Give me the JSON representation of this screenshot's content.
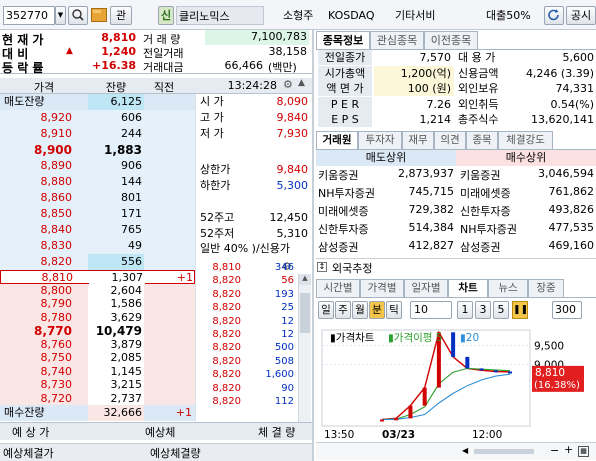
{
  "top": {
    "code": "352770",
    "btn_gwan": "관",
    "btn_sin": "신",
    "name": "클리노믹스",
    "size_cat": "소형주",
    "market": "KOSDAQ",
    "sector": "기타서비",
    "margin": "대출50%",
    "public_btn": "공시"
  },
  "summary": {
    "labels": [
      "현 재 가",
      "대    비",
      "등 락 률"
    ],
    "price": "8,810",
    "change_arrow": "▲",
    "change": "1,240",
    "rate": "+16.38",
    "vol_label": "거 래 량",
    "vol": "7,100,783",
    "prev_vol_label": "전일거래",
    "prev_vol": "38,158",
    "amount_label": "거래대금",
    "amount": "66,466",
    "amount_unit": "(백만)"
  },
  "ob_header": {
    "price": "가격",
    "remain": "잔량",
    "prev": "직전",
    "time": "13:24:28"
  },
  "ask_total_label": "매도잔량",
  "ask_total": "6,125",
  "asks": [
    {
      "p": "8,920",
      "q": "606"
    },
    {
      "p": "8,910",
      "q": "244"
    },
    {
      "p": "8,900",
      "q": "1,883"
    },
    {
      "p": "8,890",
      "q": "906"
    },
    {
      "p": "8,880",
      "q": "144"
    },
    {
      "p": "8,860",
      "q": "801"
    },
    {
      "p": "8,850",
      "q": "171"
    },
    {
      "p": "8,840",
      "q": "765"
    },
    {
      "p": "8,830",
      "q": "49"
    },
    {
      "p": "8,820",
      "q": "556"
    }
  ],
  "bids": [
    {
      "p": "8,810",
      "q": "1,307",
      "ex": "+1"
    },
    {
      "p": "8,800",
      "q": "2,604",
      "ex": ""
    },
    {
      "p": "8,790",
      "q": "1,586",
      "ex": ""
    },
    {
      "p": "8,780",
      "q": "3,629",
      "ex": ""
    },
    {
      "p": "8,770",
      "q": "10,479",
      "ex": ""
    },
    {
      "p": "8,760",
      "q": "3,879",
      "ex": ""
    },
    {
      "p": "8,750",
      "q": "2,085",
      "ex": ""
    },
    {
      "p": "8,740",
      "q": "1,145",
      "ex": ""
    },
    {
      "p": "8,730",
      "q": "3,215",
      "ex": ""
    },
    {
      "p": "8,720",
      "q": "2,737",
      "ex": ""
    }
  ],
  "bid_total_label": "매수잔량",
  "bid_total": "32,666",
  "bid_total_ex": "+1",
  "ob_footer": {
    "exp_price": "예 상 가",
    "exp_vol": "예상체",
    "exec_qty": "체 결 량"
  },
  "status_bar": {
    "a": "예상체결가",
    "b": "예상체결량"
  },
  "info": {
    "open_l": "시  가",
    "open": "8,090",
    "high_l": "고  가",
    "high": "9,840",
    "low_l": "저  가",
    "low": "7,930",
    "upper_l": "상한가",
    "upper": "9,840",
    "lower_l": "하한가",
    "lower": "5,300",
    "w52h_l": "52주고",
    "w52h": "12,450",
    "w52l_l": "52주저",
    "w52l": "5,310",
    "margin_line": "일반 40% )/신용가"
  },
  "ticks": [
    {
      "p": "8,810",
      "v": "346"
    },
    {
      "p": "8,820",
      "v": "56"
    },
    {
      "p": "8,820",
      "v": "193"
    },
    {
      "p": "8,820",
      "v": "25"
    },
    {
      "p": "8,820",
      "v": "12"
    },
    {
      "p": "8,820",
      "v": "12"
    },
    {
      "p": "8,820",
      "v": "500"
    },
    {
      "p": "8,820",
      "v": "508"
    },
    {
      "p": "8,820",
      "v": "1,600"
    },
    {
      "p": "8,820",
      "v": "90"
    },
    {
      "p": "8,820",
      "v": "112"
    }
  ],
  "right_tabs": [
    "종목정보",
    "관심종목",
    "이전종목"
  ],
  "stock_info": [
    {
      "l": "전일종가",
      "v": "7,570",
      "l2": "대 용 가",
      "v2": "5,600"
    },
    {
      "l": "시가총액",
      "v": "1,200(억)",
      "l2": "신용금액",
      "v2": "4,246  (3.39)"
    },
    {
      "l": "액 면 가",
      "v": "100 (원)",
      "l2": "외인보유",
      "v2": "74,331"
    },
    {
      "l": "P E R",
      "v": "7.26",
      "l2": "외인취득",
      "v2": "0.54(%)"
    },
    {
      "l": "E P S",
      "v": "1,214",
      "l2": "총주식수",
      "v2": "13,620,141"
    }
  ],
  "broker_tabs": [
    "거래원",
    "투자자",
    "재무",
    "의견",
    "종목",
    "체결강도"
  ],
  "broker_header": {
    "sell": "매도상위",
    "buy": "매수상위"
  },
  "brokers": [
    {
      "sn": "키움증권",
      "sv": "2,873,937",
      "bn": "키움증권",
      "bv": "3,046,594"
    },
    {
      "sn": "NH투자증권",
      "sv": "745,715",
      "bn": "미래에셋증",
      "bv": "761,862"
    },
    {
      "sn": "미래에셋증",
      "sv": "729,382",
      "bn": "신한투자증",
      "bv": "493,826"
    },
    {
      "sn": "신한투자증",
      "sv": "514,384",
      "bn": "NH투자증권",
      "bv": "477,535"
    },
    {
      "sn": "삼성증권",
      "sv": "412,827",
      "bn": "삼성증권",
      "bv": "469,160"
    }
  ],
  "foreign_est": "외국추정",
  "chart_tabs": [
    "시간별",
    "가격별",
    "일자별",
    "차트",
    "뉴스",
    "장중"
  ],
  "chart_toolbar": {
    "periods": [
      "일",
      "주",
      "월",
      "분",
      "틱"
    ],
    "interval": "10",
    "nums": [
      "1",
      "3",
      "5"
    ],
    "count": "300"
  },
  "chart_legend": {
    "price": "가격차트",
    "ma": "가격이평",
    "ma_n1": "5",
    "ma_n2": "20"
  },
  "chart_axis": {
    "x": [
      "13:50",
      "03/23",
      "12:00"
    ],
    "y_label": "9,500",
    "y_label2": "9,000",
    "cur": "8,810",
    "cur_rate": "(16.38%)"
  },
  "colors": {
    "up": "#d00000",
    "down": "#0030c0",
    "ask_bg": "#e4f0fa",
    "bid_bg": "#fbe6e6",
    "ma5": "#2ca02c",
    "ma20": "#2f8fd8"
  },
  "chart_data": {
    "type": "line",
    "x": [
      "13:50",
      "03/23",
      "12:00"
    ],
    "series": [
      {
        "name": "가격차트",
        "values": [
          7570,
          7600,
          7930,
          8400,
          9840,
          9200,
          8900,
          8850,
          8820,
          8810
        ]
      },
      {
        "name": "가격이평 5",
        "values": [
          7570,
          7580,
          7700,
          7900,
          8500,
          8800,
          8900,
          8880,
          8860,
          8840
        ]
      },
      {
        "name": "20",
        "values": [
          7570,
          7575,
          7620,
          7700,
          8000,
          8250,
          8450,
          8600,
          8700,
          8750
        ]
      }
    ],
    "ylim": [
      7400,
      9900
    ]
  }
}
